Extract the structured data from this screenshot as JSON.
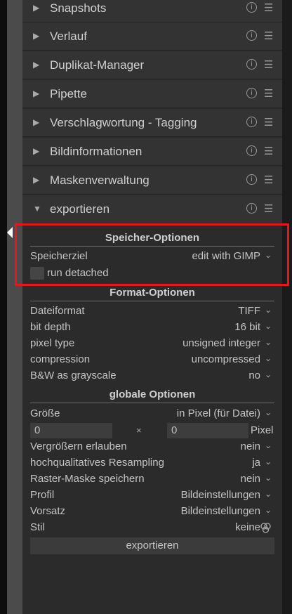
{
  "headers": [
    {
      "name": "Snapshots"
    },
    {
      "name": "Verlauf"
    },
    {
      "name": "Duplikat-Manager"
    },
    {
      "name": "Pipette"
    },
    {
      "name": "Verschlagwortung - Tagging"
    },
    {
      "name": "Bildinformationen"
    },
    {
      "name": "Maskenverwaltung"
    },
    {
      "name": "exportieren",
      "expanded": true
    }
  ],
  "icons": {
    "collapsed": "▶",
    "expanded": "▼",
    "info": "i",
    "menu": "☰",
    "chevron": "⌄"
  },
  "storage": {
    "title": "Speicher-Optionen",
    "target_label": "Speicherziel",
    "target_value": "edit with GIMP",
    "run_detached_label": "run detached",
    "run_detached_checked": false
  },
  "format": {
    "title": "Format-Optionen",
    "rows": [
      {
        "label": "Dateiformat",
        "value": "TIFF"
      },
      {
        "label": "bit depth",
        "value": "16 bit"
      },
      {
        "label": "pixel type",
        "value": "unsigned integer"
      },
      {
        "label": "compression",
        "value": "uncompressed"
      },
      {
        "label": "B&W as grayscale",
        "value": "no"
      }
    ]
  },
  "global": {
    "title": "globale Optionen",
    "size_label": "Größe",
    "size_value": "in Pixel (für Datei)",
    "width": "0",
    "height": "0",
    "times": "×",
    "unit": "Pixel",
    "rows": [
      {
        "label": "Vergrößern erlauben",
        "value": "nein"
      },
      {
        "label": "hochqualitatives Resampling",
        "value": "ja"
      },
      {
        "label": "Raster-Maske speichern",
        "value": "nein"
      },
      {
        "label": "Profil",
        "value": "Bildeinstellungen"
      },
      {
        "label": "Vorsatz",
        "value": "Bildeinstellungen"
      }
    ],
    "style_label": "Stil",
    "style_value": "keine"
  },
  "export_button": "exportieren",
  "colors": {
    "highlight": "#e8141e",
    "panel": "#2b2b2b",
    "header": "#333333"
  }
}
